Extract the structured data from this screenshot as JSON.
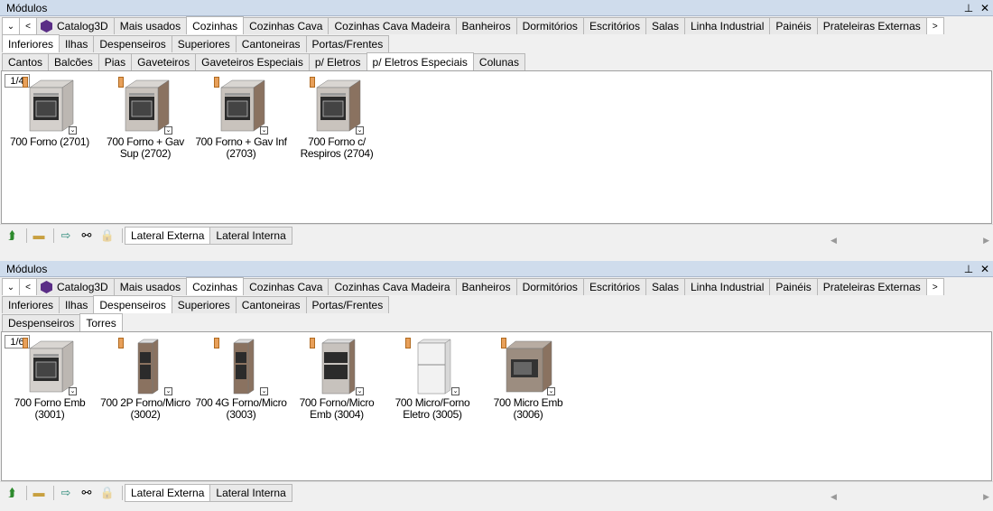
{
  "panels": [
    {
      "title": "Módulos",
      "catalog": "Catalog3D",
      "tabs1": [
        "Mais usados",
        "Cozinhas",
        "Cozinhas Cava",
        "Cozinhas Cava Madeira",
        "Banheiros",
        "Dormitórios",
        "Escritórios",
        "Salas",
        "Linha Industrial",
        "Painéis",
        "Prateleiras Externas"
      ],
      "tabs1_active": 1,
      "tabs2": [
        "Inferiores",
        "Ilhas",
        "Despenseiros",
        "Superiores",
        "Cantoneiras",
        "Portas/Frentes"
      ],
      "tabs2_active": 0,
      "tabs3": [
        "Cantos",
        "Balcões",
        "Pias",
        "Gaveteiros",
        "Gaveteiros Especiais",
        "p/ Eletros",
        "p/ Eletros Especiais",
        "Colunas"
      ],
      "tabs3_active": 6,
      "pager": "1/4",
      "items": [
        {
          "label": "700 Forno (2701)",
          "kind": "base"
        },
        {
          "label": "700 Forno + Gav Sup (2702)",
          "kind": "base-wood"
        },
        {
          "label": "700 Forno + Gav Inf (2703)",
          "kind": "base-wood"
        },
        {
          "label": "700 Forno c/ Respiros (2704)",
          "kind": "base-wood"
        }
      ],
      "bottom_tabs": [
        "Lateral Externa",
        "Lateral Interna"
      ],
      "bottom_active": 0
    },
    {
      "title": "Módulos",
      "catalog": "Catalog3D",
      "tabs1": [
        "Mais usados",
        "Cozinhas",
        "Cozinhas Cava",
        "Cozinhas Cava Madeira",
        "Banheiros",
        "Dormitórios",
        "Escritórios",
        "Salas",
        "Linha Industrial",
        "Painéis",
        "Prateleiras Externas"
      ],
      "tabs1_active": 1,
      "tabs2": [
        "Inferiores",
        "Ilhas",
        "Despenseiros",
        "Superiores",
        "Cantoneiras",
        "Portas/Frentes"
      ],
      "tabs2_active": 2,
      "tabs3": [
        "Despenseiros",
        "Torres"
      ],
      "tabs3_active": 1,
      "pager": "1/6",
      "items": [
        {
          "label": "700 Forno Emb (3001)",
          "kind": "base"
        },
        {
          "label": "700 2P Forno/Micro (3002)",
          "kind": "tall-wood"
        },
        {
          "label": "700 4G Forno/Micro (3003)",
          "kind": "tall-wood"
        },
        {
          "label": "700 Forno/Micro Emb (3004)",
          "kind": "tall"
        },
        {
          "label": "700 Micro/Forno Eletro (3005)",
          "kind": "open"
        },
        {
          "label": "700 Micro Emb (3006)",
          "kind": "micro"
        }
      ],
      "bottom_tabs": [
        "Lateral Externa",
        "Lateral Interna"
      ],
      "bottom_active": 0
    }
  ],
  "icons": [
    "back-icon",
    "ruler-icon",
    "import-icon",
    "binoculars-icon",
    "lock-icon"
  ],
  "colors": {
    "titlebar": "#cfdcec",
    "oven_tag": "#e8a05a",
    "catalog_icon": "#5a2d86",
    "wood": "#8a7260"
  }
}
